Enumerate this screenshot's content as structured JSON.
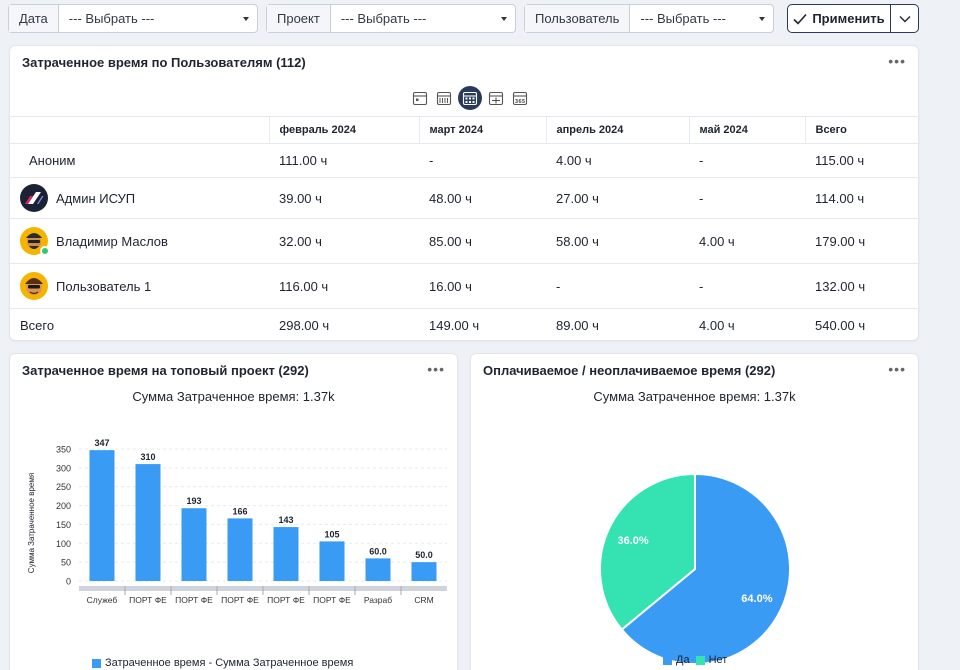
{
  "filters": {
    "date_label": "Дата",
    "date_value": "--- Выбрать ---",
    "project_label": "Проект",
    "project_value": "--- Выбрать ---",
    "user_label": "Пользователь",
    "user_value": "--- Выбрать ---",
    "apply_label": "Применить"
  },
  "users_card": {
    "title": "Затраченное время по Пользователям (112)",
    "menu": "•••",
    "columns": [
      "",
      "февраль 2024",
      "март 2024",
      "апрель 2024",
      "май 2024",
      "Всего"
    ],
    "rows": [
      {
        "name": "Аноним",
        "values": [
          "111.00 ч",
          "-",
          "4.00 ч",
          "-",
          "115.00 ч"
        ]
      },
      {
        "name": "Админ ИСУП",
        "values": [
          "39.00 ч",
          "48.00 ч",
          "27.00 ч",
          "-",
          "114.00 ч"
        ]
      },
      {
        "name": "Владимир Маслов",
        "values": [
          "32.00 ч",
          "85.00 ч",
          "58.00 ч",
          "4.00 ч",
          "179.00 ч"
        ]
      },
      {
        "name": "Пользователь 1",
        "values": [
          "116.00 ч",
          "16.00 ч",
          "-",
          "-",
          "132.00 ч"
        ]
      }
    ],
    "total_row": {
      "name": "Всего",
      "values": [
        "298.00 ч",
        "149.00 ч",
        "89.00 ч",
        "4.00 ч",
        "540.00 ч"
      ]
    }
  },
  "project_card": {
    "title": "Затраченное время на топовый проект (292)",
    "menu": "•••"
  },
  "pay_card": {
    "title": "Оплачиваемое / неоплачиваемое время (292)",
    "menu": "•••"
  },
  "colors": {
    "bar": "#3a9bf4",
    "pie_yes": "#3a9bf4",
    "pie_no": "#34e3b1",
    "accent": "#2a3a5c"
  },
  "chart_data": [
    {
      "type": "bar",
      "title": "Сумма Затраченное время: 1.37k",
      "ylabel": "Сумма Затраченное время",
      "categories": [
        "Служеб",
        "ПОРТ ФЕ",
        "ПОРТ ФЕ",
        "ПОРТ ФЕ",
        "ПОРТ ФЕ",
        "ПОРТ ФЕ",
        "Разраб",
        "CRM"
      ],
      "values": [
        347,
        310,
        193,
        166,
        143,
        105,
        60,
        50
      ],
      "value_labels": [
        "347",
        "310",
        "193",
        "166",
        "143",
        "105",
        "60.0",
        "50.0"
      ],
      "yticks": [
        "0",
        "50",
        "100",
        "150",
        "200",
        "250",
        "300",
        "350"
      ],
      "ylim": [
        0,
        350
      ],
      "legend": "Затраченное время - Сумма Затраченное время",
      "grid": true
    },
    {
      "type": "pie",
      "title": "Сумма Затраченное время: 1.37k",
      "labels": [
        "Да",
        "Нет"
      ],
      "values": [
        64.0,
        36.0
      ],
      "value_labels": [
        "64.0%",
        "36.0%"
      ]
    }
  ]
}
